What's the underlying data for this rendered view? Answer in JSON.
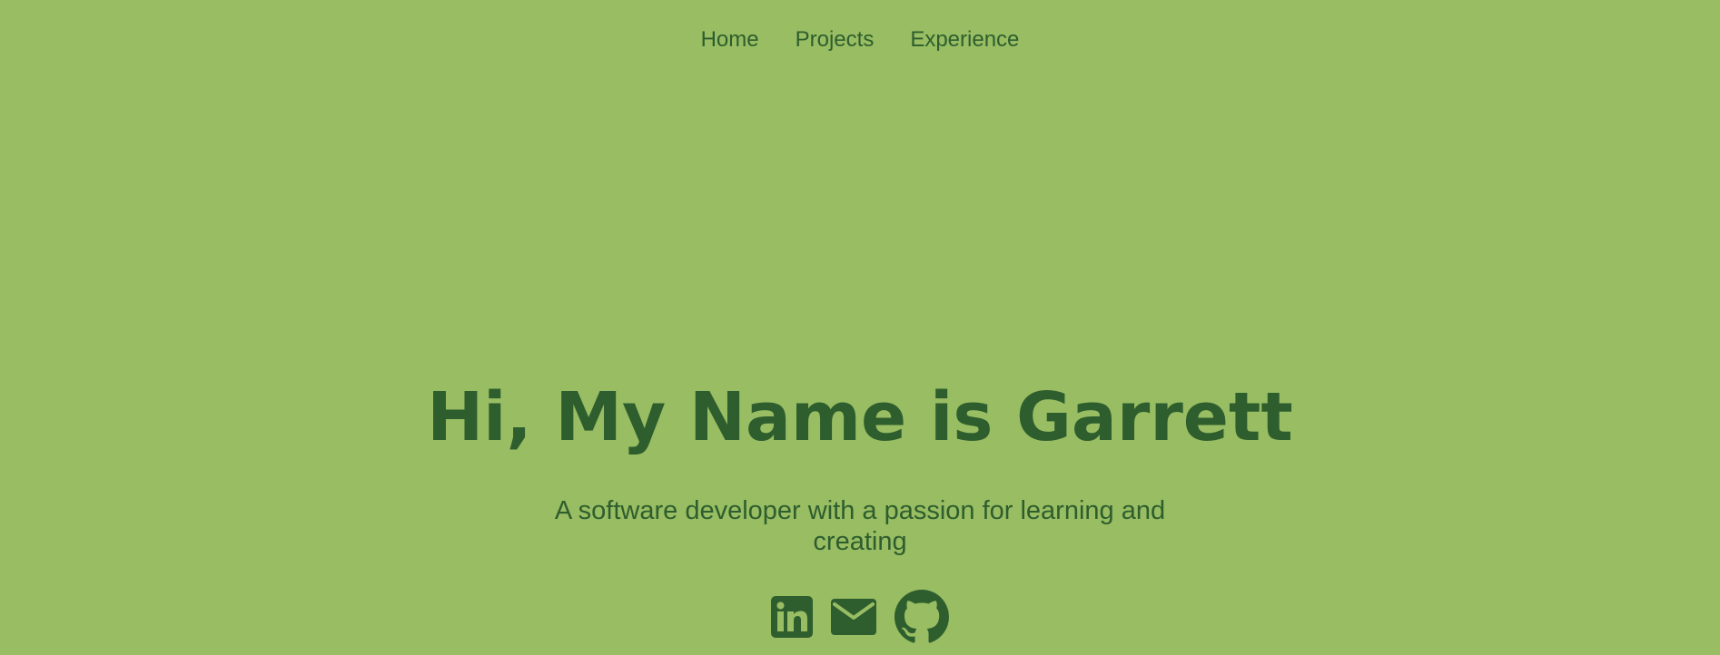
{
  "nav": {
    "items": [
      {
        "label": "Home"
      },
      {
        "label": "Projects"
      },
      {
        "label": "Experience"
      }
    ]
  },
  "hero": {
    "title": "Hi, My Name is Garrett",
    "subtitle": "A software developer with a passion for learning and creating"
  },
  "socials": [
    {
      "icon": "linkedin-icon"
    },
    {
      "icon": "mail-icon"
    },
    {
      "icon": "github-icon"
    }
  ],
  "colors": {
    "background": "#98bd62",
    "text": "#2e5e2e"
  }
}
